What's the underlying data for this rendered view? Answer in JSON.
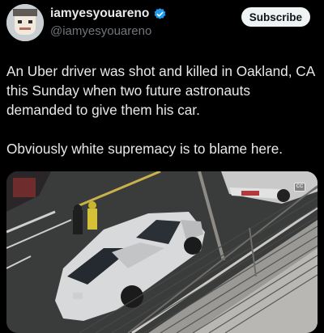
{
  "author": {
    "display_name": "iamyesyouareno",
    "handle": "@iamyesyouareno",
    "avatar_icon": "pixel-avatar-icon",
    "verified_icon": "verified-badge-icon",
    "verified_color": "#1d9bf0"
  },
  "header": {
    "subscribe_label": "Subscribe"
  },
  "tweet": {
    "paragraphs": [
      "An Uber driver was shot and killed in Oakland, CA this Sunday when two future astronauts demanded to give them his car.",
      "Obviously white supremacy is to blame here."
    ]
  },
  "media": {
    "type": "video-thumbnail",
    "caption_icon": "closed-captions-icon"
  },
  "colors": {
    "background": "#000000",
    "text": "#e7e9ea",
    "secondary_text": "#71767b",
    "button_bg": "#eff3f4"
  }
}
